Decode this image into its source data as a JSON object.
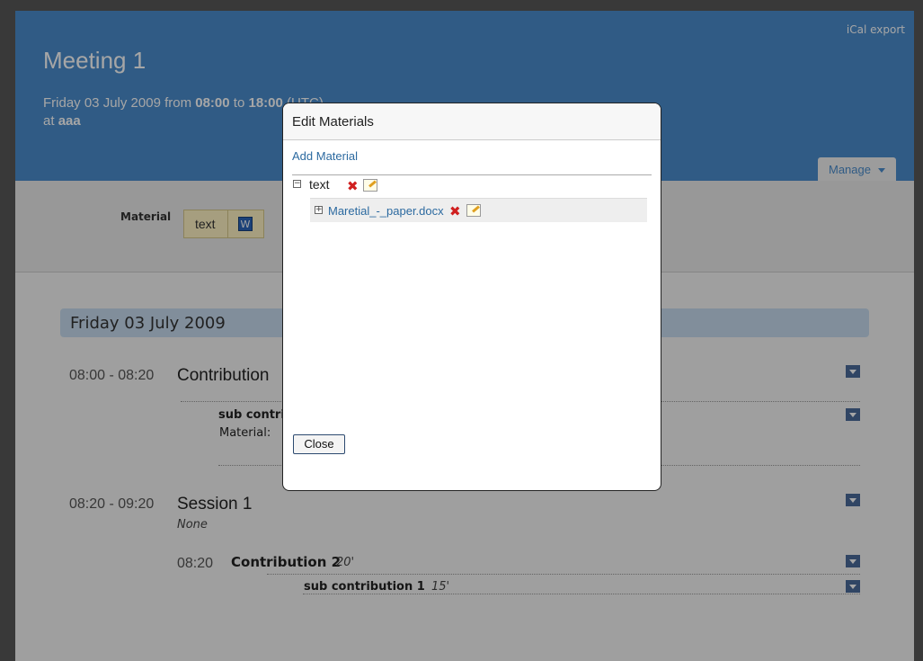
{
  "header": {
    "ical_label": "iCal export",
    "title": "Meeting 1",
    "date_prefix": "Friday 03 July 2009 from ",
    "start_time": "08:00",
    "to": " to ",
    "end_time": "18:00",
    "tz": " (UTC)",
    "at": "at ",
    "location": "aaa",
    "manage_label": "Manage"
  },
  "material_bar": {
    "label": "Material",
    "chip_text": "text"
  },
  "timetable": {
    "day": "Friday 03 July 2009",
    "items": [
      {
        "time": "08:00 - 08:20",
        "title": "Contribution",
        "sub_title": "sub contrib",
        "material_label": "Material:"
      },
      {
        "time": "08:20 - 09:20",
        "title": "Session 1",
        "convener": "None",
        "child_time": "08:20",
        "child_title": "Contribution 2",
        "child_duration": "20'",
        "sub_title": "sub contribution 1",
        "sub_duration": "15'"
      }
    ]
  },
  "dialog": {
    "title": "Edit Materials",
    "add_material": "Add Material",
    "node_label": "text",
    "file_name": "Maretial_-_paper.docx",
    "close_label": "Close"
  },
  "colors": {
    "header_bg": "#4a8ccc",
    "link": "#2c6aa0",
    "day_header": "#c6dbef"
  }
}
